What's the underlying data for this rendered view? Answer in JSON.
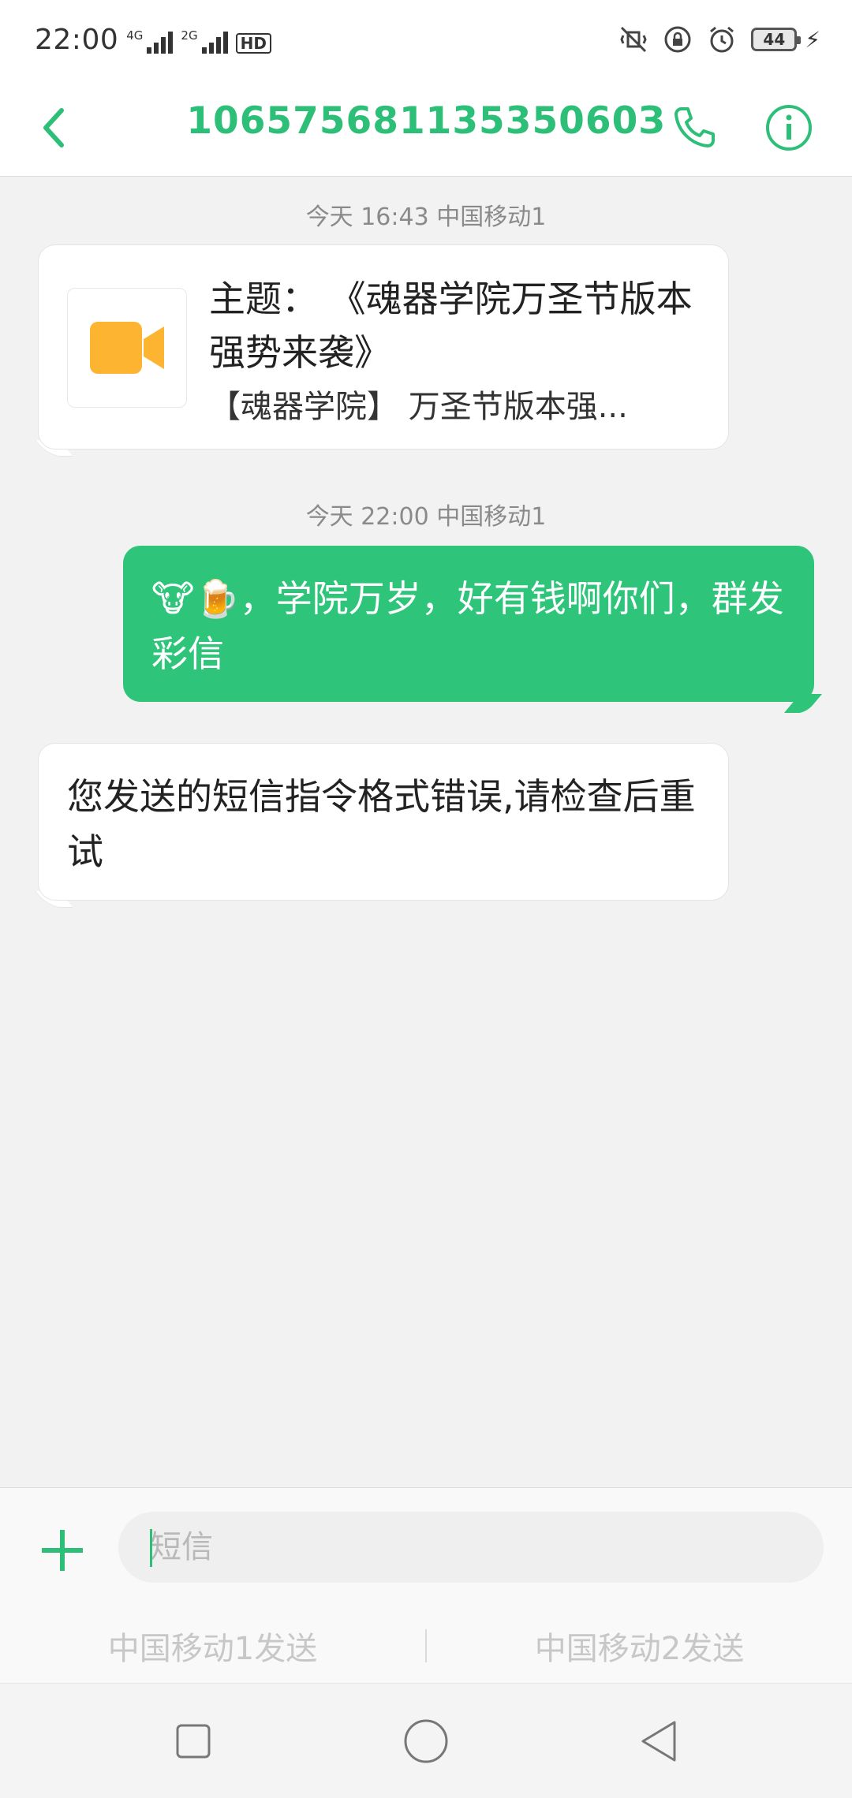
{
  "status_bar": {
    "time": "22:00",
    "network1_tag": "4G",
    "network1_sub": "4G",
    "network2_tag": "2G",
    "hd_label": "HD",
    "battery": "44"
  },
  "header": {
    "contact": "10657568113535060З",
    "icons": [
      "back-arrow-icon",
      "phone-icon",
      "info-icon"
    ]
  },
  "conversation": {
    "timestamp1": "今天 16:43  中国移动1",
    "mms": {
      "subject": "主题： 《魂器学院万圣节版本强势来袭》",
      "preview": "【魂器学院】  万圣节版本强..."
    },
    "timestamp2": "今天 22:00  中国移动1",
    "sent_message": "🐮🍺，学院万岁，好有钱啊你们，群发彩信",
    "reply_message": "您发送的短信指令格式错误,请检查后重试"
  },
  "compose": {
    "placeholder": "短信",
    "send_sim1": "中国移动1发送",
    "send_sim2": "中国移动2发送"
  },
  "colors": {
    "accent": "#2dbf78",
    "sent_bubble": "#2ec57b",
    "background": "#f2f2f2"
  }
}
